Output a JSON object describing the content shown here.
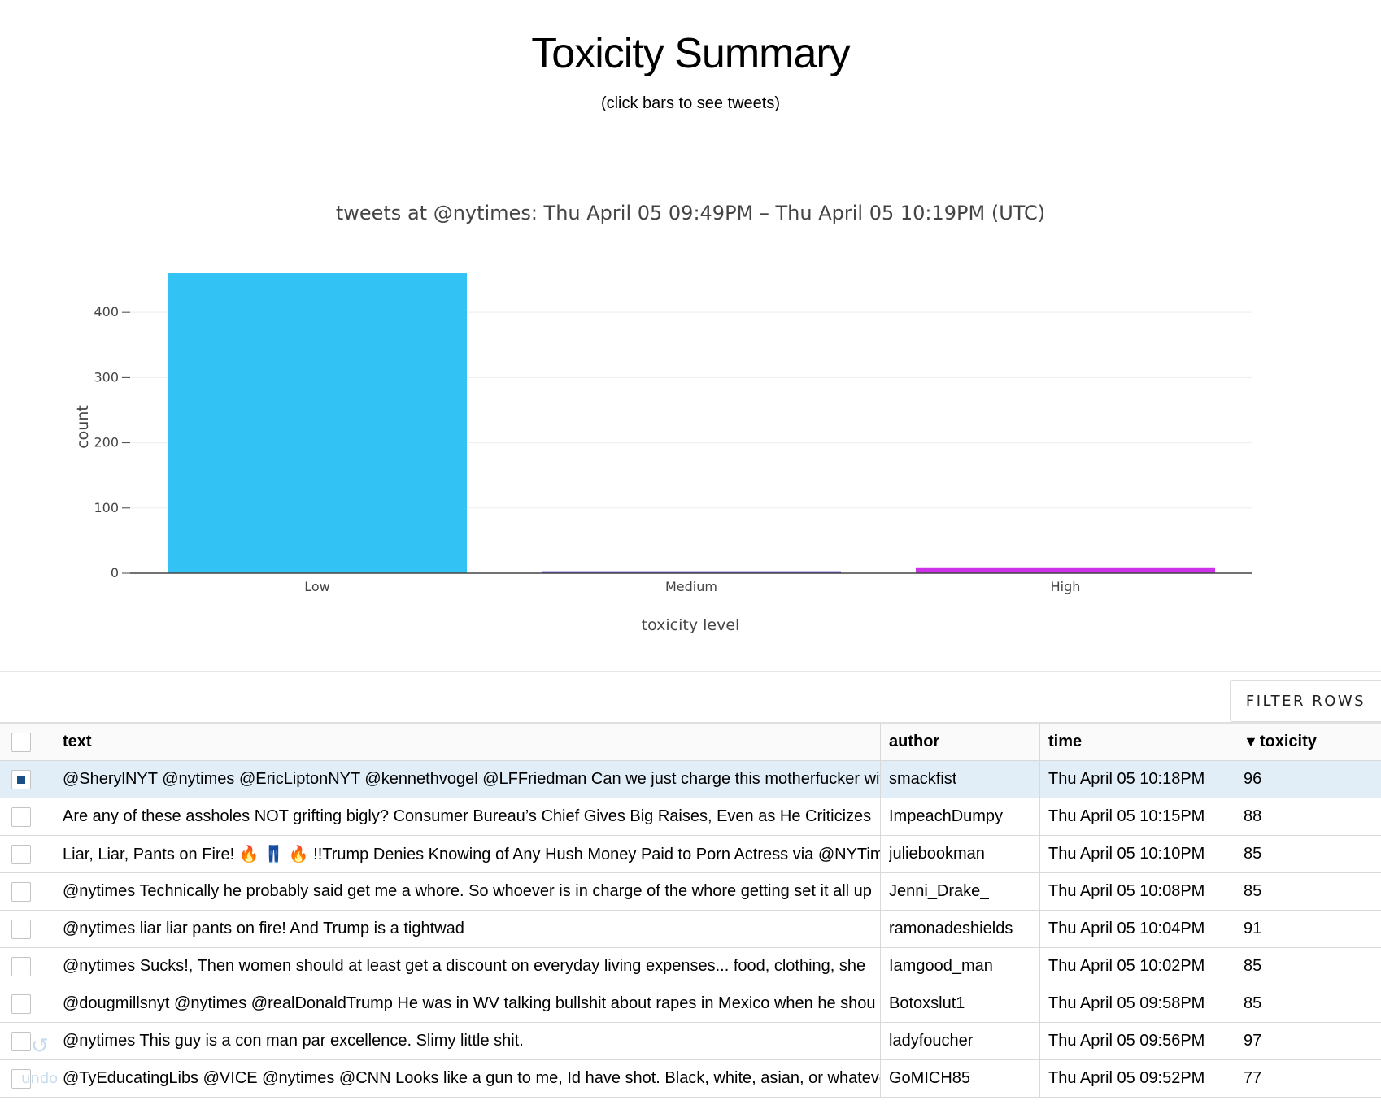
{
  "page": {
    "title": "Toxicity Summary",
    "subtitle": "(click bars to see tweets)"
  },
  "chart_data": {
    "type": "bar",
    "title": "tweets at @nytimes: Thu April 05 09:49PM  –  Thu April 05 10:19PM (UTC)",
    "xlabel": "toxicity level",
    "ylabel": "count",
    "categories": [
      "Low",
      "Medium",
      "High"
    ],
    "values": [
      460,
      3,
      9
    ],
    "colors": [
      "#33c2f4",
      "#6c5ce7",
      "#cc33e8"
    ],
    "ylim": [
      0,
      480
    ],
    "yticks": [
      0,
      100,
      200,
      300,
      400
    ],
    "grid": true,
    "legend": "none"
  },
  "toolbar": {
    "filter_label": "FILTER ROWS"
  },
  "table": {
    "columns": {
      "text": "text",
      "author": "author",
      "time": "time",
      "toxicity": "toxicity",
      "sort_indicator": "▼"
    },
    "rows": [
      {
        "text": "@SherylNYT @nytimes @EricLiptonNYT @kennethvogel @LFFriedman Can we just charge this motherfucker wit",
        "author": "smackfist",
        "time": "Thu April 05 10:18PM",
        "toxicity": "96",
        "selected": true
      },
      {
        "text": "Are any of these assholes NOT grifting bigly? Consumer Bureau’s Chief Gives Big Raises, Even as He Criticizes",
        "author": "ImpeachDumpy",
        "time": "Thu April 05 10:15PM",
        "toxicity": "88",
        "selected": false
      },
      {
        "text": "Liar, Liar, Pants on Fire! 🔥 👖 🔥 !!Trump Denies Knowing of Any Hush Money Paid to Porn Actress via @NYTim",
        "author": "juliebookman",
        "time": "Thu April 05 10:10PM",
        "toxicity": "85",
        "selected": false
      },
      {
        "text": "@nytimes Technically he probably said get me a whore. So whoever is in charge of the whore getting set it all up",
        "author": "Jenni_Drake_",
        "time": "Thu April 05 10:08PM",
        "toxicity": "85",
        "selected": false
      },
      {
        "text": "@nytimes liar liar pants on fire! And Trump is a tightwad",
        "author": "ramonadeshields",
        "time": "Thu April 05 10:04PM",
        "toxicity": "91",
        "selected": false
      },
      {
        "text": "@nytimes Sucks!, Then women should at least get a discount on everyday living expenses... food, clothing, she",
        "author": "Iamgood_man",
        "time": "Thu April 05 10:02PM",
        "toxicity": "85",
        "selected": false
      },
      {
        "text": "@dougmillsnyt @nytimes @realDonaldTrump He was in WV talking bullshit about rapes in Mexico when he shou",
        "author": "Botoxslut1",
        "time": "Thu April 05 09:58PM",
        "toxicity": "85",
        "selected": false
      },
      {
        "text": "@nytimes This guy is a con man par excellence. Slimy little shit.",
        "author": "ladyfoucher",
        "time": "Thu April 05 09:56PM",
        "toxicity": "97",
        "selected": false
      },
      {
        "text": "@TyEducatingLibs @VICE @nytimes @CNN Looks like a gun to me, Id have shot. Black, white, asian, or whateve",
        "author": "GoMICH85",
        "time": "Thu April 05 09:52PM",
        "toxicity": "77",
        "selected": false
      }
    ]
  },
  "undo": {
    "label": "undo",
    "icon": "undo-icon"
  }
}
